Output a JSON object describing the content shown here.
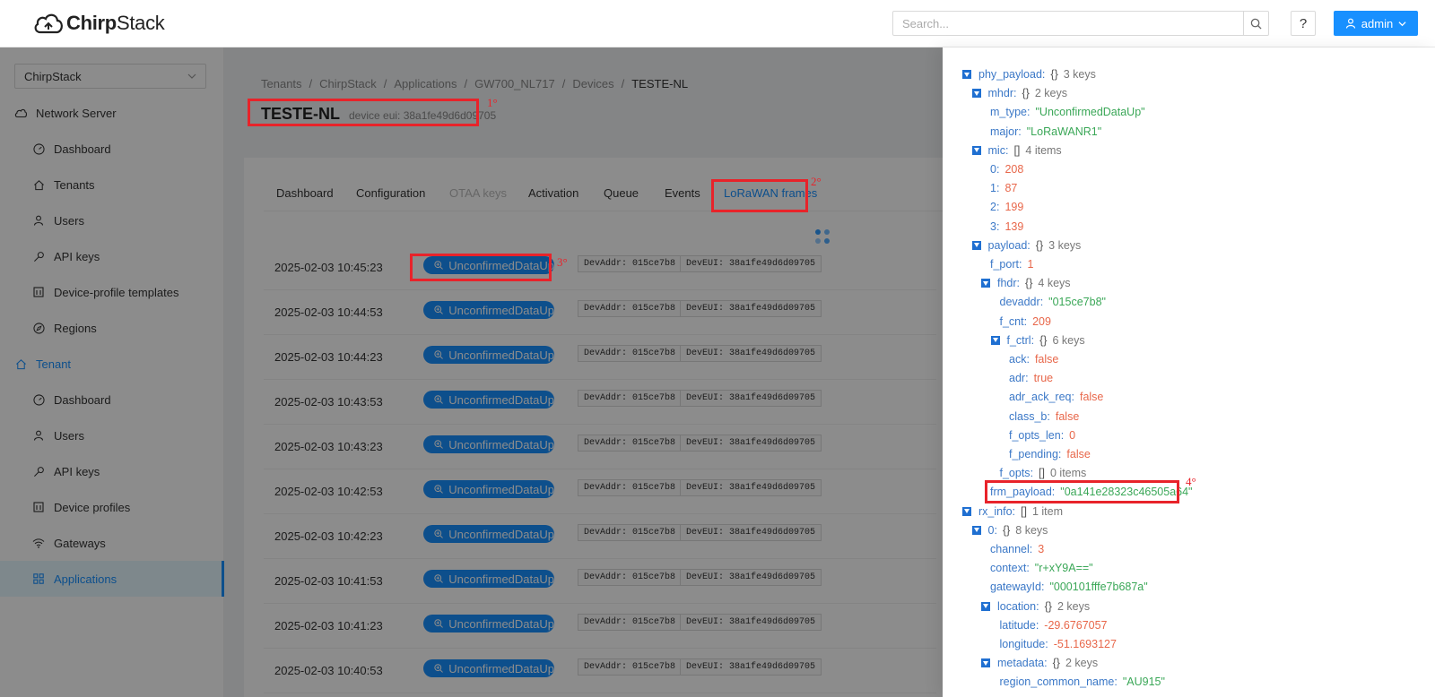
{
  "header": {
    "logo_text_bold": "Chirp",
    "logo_text": "Stack",
    "search_placeholder": "Search...",
    "help_label": "?",
    "user_label": "admin"
  },
  "sidebar": {
    "tenant_selected": "ChirpStack",
    "network_server_label": "Network Server",
    "network_items": [
      {
        "label": "Dashboard",
        "icon": "dashboard-icon"
      },
      {
        "label": "Tenants",
        "icon": "home-icon"
      },
      {
        "label": "Users",
        "icon": "user-icon"
      },
      {
        "label": "API keys",
        "icon": "key-icon"
      },
      {
        "label": "Device-profile templates",
        "icon": "template-icon"
      },
      {
        "label": "Regions",
        "icon": "compass-icon"
      }
    ],
    "tenant_label": "Tenant",
    "tenant_items": [
      {
        "label": "Dashboard",
        "icon": "dashboard-icon"
      },
      {
        "label": "Users",
        "icon": "user-icon"
      },
      {
        "label": "API keys",
        "icon": "key-icon"
      },
      {
        "label": "Device profiles",
        "icon": "template-icon"
      },
      {
        "label": "Gateways",
        "icon": "wifi-icon"
      },
      {
        "label": "Applications",
        "icon": "appstore-icon"
      }
    ]
  },
  "breadcrumb": [
    "Tenants",
    "ChirpStack",
    "Applications",
    "GW700_NL717",
    "Devices",
    "TESTE-NL"
  ],
  "page": {
    "title": "TESTE-NL",
    "subtitle": "device eui: 38a1fe49d6d09705"
  },
  "tabs": [
    {
      "label": "Dashboard",
      "state": "normal"
    },
    {
      "label": "Configuration",
      "state": "normal"
    },
    {
      "label": "OTAA keys",
      "state": "disabled"
    },
    {
      "label": "Activation",
      "state": "normal"
    },
    {
      "label": "Queue",
      "state": "normal"
    },
    {
      "label": "Events",
      "state": "normal"
    },
    {
      "label": "LoRaWAN frames",
      "state": "active"
    }
  ],
  "frames": [
    {
      "time": "2025-02-03 10:45:23",
      "type": "UnconfirmedDataUp",
      "dev_addr": "DevAddr: 015ce7b8",
      "dev_eui": "DevEUI: 38a1fe49d6d09705"
    },
    {
      "time": "2025-02-03 10:44:53",
      "type": "UnconfirmedDataUp",
      "dev_addr": "DevAddr: 015ce7b8",
      "dev_eui": "DevEUI: 38a1fe49d6d09705"
    },
    {
      "time": "2025-02-03 10:44:23",
      "type": "UnconfirmedDataUp",
      "dev_addr": "DevAddr: 015ce7b8",
      "dev_eui": "DevEUI: 38a1fe49d6d09705"
    },
    {
      "time": "2025-02-03 10:43:53",
      "type": "UnconfirmedDataUp",
      "dev_addr": "DevAddr: 015ce7b8",
      "dev_eui": "DevEUI: 38a1fe49d6d09705"
    },
    {
      "time": "2025-02-03 10:43:23",
      "type": "UnconfirmedDataUp",
      "dev_addr": "DevAddr: 015ce7b8",
      "dev_eui": "DevEUI: 38a1fe49d6d09705"
    },
    {
      "time": "2025-02-03 10:42:53",
      "type": "UnconfirmedDataUp",
      "dev_addr": "DevAddr: 015ce7b8",
      "dev_eui": "DevEUI: 38a1fe49d6d09705"
    },
    {
      "time": "2025-02-03 10:42:23",
      "type": "UnconfirmedDataUp",
      "dev_addr": "DevAddr: 015ce7b8",
      "dev_eui": "DevEUI: 38a1fe49d6d09705"
    },
    {
      "time": "2025-02-03 10:41:53",
      "type": "UnconfirmedDataUp",
      "dev_addr": "DevAddr: 015ce7b8",
      "dev_eui": "DevEUI: 38a1fe49d6d09705"
    },
    {
      "time": "2025-02-03 10:41:23",
      "type": "UnconfirmedDataUp",
      "dev_addr": "DevAddr: 015ce7b8",
      "dev_eui": "DevEUI: 38a1fe49d6d09705"
    },
    {
      "time": "2025-02-03 10:40:53",
      "type": "UnconfirmedDataUp",
      "dev_addr": "DevAddr: 015ce7b8",
      "dev_eui": "DevEUI: 38a1fe49d6d09705"
    }
  ],
  "json_tree": [
    {
      "depth": 0,
      "toggle": true,
      "key": "phy_payload",
      "brace": "{}",
      "meta": "3 keys"
    },
    {
      "depth": 1,
      "toggle": true,
      "key": "mhdr",
      "brace": "{}",
      "meta": "2 keys"
    },
    {
      "depth": 2,
      "toggle": false,
      "key": "m_type",
      "value": "\"UnconfirmedDataUp\"",
      "vtype": "str"
    },
    {
      "depth": 2,
      "toggle": false,
      "key": "major",
      "value": "\"LoRaWANR1\"",
      "vtype": "str"
    },
    {
      "depth": 1,
      "toggle": true,
      "key": "mic",
      "brace": "[]",
      "meta": "4 items"
    },
    {
      "depth": 2,
      "toggle": false,
      "key": "0",
      "value": "208",
      "vtype": "num"
    },
    {
      "depth": 2,
      "toggle": false,
      "key": "1",
      "value": "87",
      "vtype": "num"
    },
    {
      "depth": 2,
      "toggle": false,
      "key": "2",
      "value": "199",
      "vtype": "num"
    },
    {
      "depth": 2,
      "toggle": false,
      "key": "3",
      "value": "139",
      "vtype": "num"
    },
    {
      "depth": 1,
      "toggle": true,
      "key": "payload",
      "brace": "{}",
      "meta": "3 keys"
    },
    {
      "depth": 2,
      "toggle": false,
      "key": "f_port",
      "value": "1",
      "vtype": "num"
    },
    {
      "depth": 2,
      "toggle": true,
      "key": "fhdr",
      "brace": "{}",
      "meta": "4 keys"
    },
    {
      "depth": 3,
      "toggle": false,
      "key": "devaddr",
      "value": "\"015ce7b8\"",
      "vtype": "str"
    },
    {
      "depth": 3,
      "toggle": false,
      "key": "f_cnt",
      "value": "209",
      "vtype": "num"
    },
    {
      "depth": 3,
      "toggle": true,
      "key": "f_ctrl",
      "brace": "{}",
      "meta": "6 keys"
    },
    {
      "depth": 4,
      "toggle": false,
      "key": "ack",
      "value": "false",
      "vtype": "bool"
    },
    {
      "depth": 4,
      "toggle": false,
      "key": "adr",
      "value": "true",
      "vtype": "bool"
    },
    {
      "depth": 4,
      "toggle": false,
      "key": "adr_ack_req",
      "value": "false",
      "vtype": "bool"
    },
    {
      "depth": 4,
      "toggle": false,
      "key": "class_b",
      "value": "false",
      "vtype": "bool"
    },
    {
      "depth": 4,
      "toggle": false,
      "key": "f_opts_len",
      "value": "0",
      "vtype": "num"
    },
    {
      "depth": 4,
      "toggle": false,
      "key": "f_pending",
      "value": "false",
      "vtype": "bool"
    },
    {
      "depth": 3,
      "toggle": false,
      "key": "f_opts",
      "brace": "[]",
      "meta": "0 items"
    },
    {
      "depth": 2,
      "toggle": false,
      "key": "frm_payload",
      "value": "\"0a141e28323c46505a64\"",
      "vtype": "str"
    },
    {
      "depth": 0,
      "toggle": true,
      "key": "rx_info",
      "brace": "[]",
      "meta": "1 item"
    },
    {
      "depth": 1,
      "toggle": true,
      "key": "0",
      "brace": "{}",
      "meta": "8 keys"
    },
    {
      "depth": 2,
      "toggle": false,
      "key": "channel",
      "value": "3",
      "vtype": "num"
    },
    {
      "depth": 2,
      "toggle": false,
      "key": "context",
      "value": "\"r+xY9A==\"",
      "vtype": "str"
    },
    {
      "depth": 2,
      "toggle": false,
      "key": "gatewayId",
      "value": "\"000101fffe7b687a\"",
      "vtype": "str"
    },
    {
      "depth": 2,
      "toggle": true,
      "key": "location",
      "brace": "{}",
      "meta": "2 keys"
    },
    {
      "depth": 3,
      "toggle": false,
      "key": "latitude",
      "value": "-29.6767057",
      "vtype": "num"
    },
    {
      "depth": 3,
      "toggle": false,
      "key": "longitude",
      "value": "-51.1693127",
      "vtype": "num"
    },
    {
      "depth": 2,
      "toggle": true,
      "key": "metadata",
      "brace": "{}",
      "meta": "2 keys"
    },
    {
      "depth": 3,
      "toggle": false,
      "key": "region_common_name",
      "value": "\"AU915\"",
      "vtype": "str"
    }
  ],
  "annotations": [
    "1°",
    "2°",
    "3°",
    "4°"
  ],
  "colors": {
    "primary": "#1890ff",
    "annotation": "#e8232a",
    "json_string": "#3aa757",
    "json_number": "#e8674a"
  }
}
